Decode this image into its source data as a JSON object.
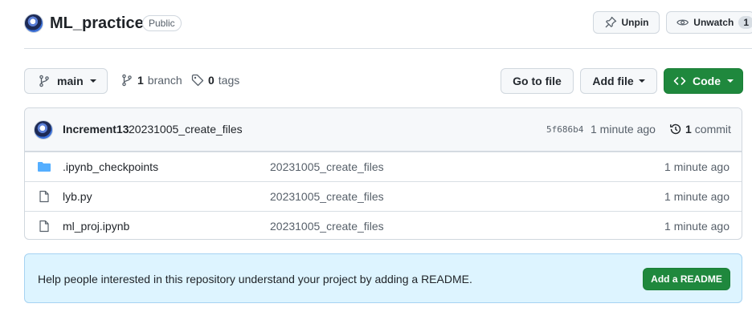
{
  "repo": {
    "name": "ML_practice",
    "visibility": "Public"
  },
  "header_actions": {
    "unpin_label": "Unpin",
    "unwatch_label": "Unwatch",
    "watch_count": "1"
  },
  "toolbar": {
    "branch_selector": "main",
    "branch_count": "1",
    "branch_word": "branch",
    "tag_count": "0",
    "tag_word": "tags",
    "go_to_file": "Go to file",
    "add_file": "Add file",
    "code": "Code"
  },
  "latest_commit": {
    "author": "Increment13",
    "message": "20231005_create_files",
    "sha": "5f686b4",
    "time": "1 minute ago",
    "commit_count": "1",
    "commit_word": "commit"
  },
  "files": [
    {
      "name": ".ipynb_checkpoints",
      "type": "folder",
      "message": "20231005_create_files",
      "time": "1 minute ago"
    },
    {
      "name": "lyb.py",
      "type": "file",
      "message": "20231005_create_files",
      "time": "1 minute ago"
    },
    {
      "name": "ml_proj.ipynb",
      "type": "file",
      "message": "20231005_create_files",
      "time": "1 minute ago"
    }
  ],
  "readme_banner": {
    "text": "Help people interested in this repository understand your project by adding a README.",
    "button": "Add a README"
  },
  "colors": {
    "green": "#1f883d",
    "folder": "#54aeff",
    "banner_bg": "#ddf4ff"
  }
}
